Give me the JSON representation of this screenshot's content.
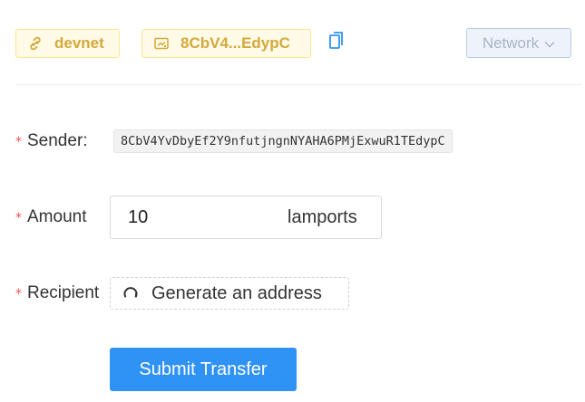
{
  "header": {
    "network_tag": "devnet",
    "address_tag": "8CbV4...EdypC",
    "network_button": "Network",
    "icons": {
      "network": "link-icon",
      "address": "wallet-icon",
      "copy": "copy-icon",
      "dropdown": "chevron-down-icon"
    },
    "colors": {
      "tag_text": "#d4a83b",
      "tag_bg": "#fffbe6",
      "network_button_bg": "#eef3fb"
    }
  },
  "form": {
    "required_mark": "*",
    "sender": {
      "label": "Sender:",
      "value": "8CbV4YvDbyEf2Y9nfutjngnNYAHA6PMjExwuR1TEdypC"
    },
    "amount": {
      "label": "Amount",
      "value": "10",
      "suffix": "lamports"
    },
    "recipient": {
      "label": "Recipient",
      "generate_button": "Generate an address",
      "icon": "reload-icon"
    },
    "submit_button": "Submit Transfer",
    "colors": {
      "primary": "#2f92f5",
      "required": "#ff4d4f"
    }
  }
}
